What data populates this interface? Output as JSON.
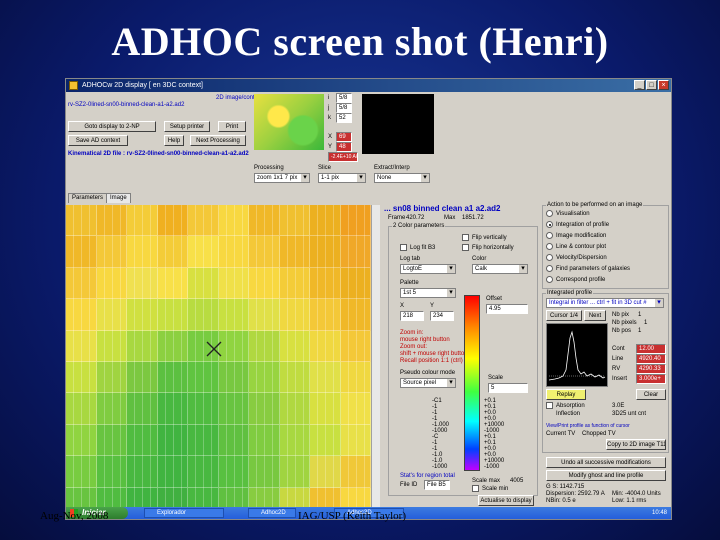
{
  "slide": {
    "title": "ADHOC screen shot (Henri)",
    "footer_left": "Aug-Nov, 2008",
    "footer_center": "IAG/USP (Keith Taylor)"
  },
  "window": {
    "title": "ADHOCw 2D display   [ en 3DC context]",
    "controls": [
      "_",
      "□",
      "×"
    ]
  },
  "header": {
    "context_line1": "2D image/context modes:",
    "context_line2": "rv-SZ2-0lined-sn00-binned-clean-a1-a2.ad2",
    "loaded_file": "Kinematical 2D file : rv-SZ2-0lined-sn00-binned-clean-a1-a2.ad2",
    "i_label": "i",
    "i_value": "5/8",
    "j_label": "j",
    "j_value": "5/8",
    "k_label": "k",
    "k_value": "52",
    "x_label": "X",
    "x_value": "69",
    "y_label": "Y",
    "y_value": "48",
    "coord_value": "-2.4E+10 A/R",
    "processing_label": "Processing",
    "processing_value": "zoom 1x1 7 pix",
    "slice_label": "Slice",
    "slice_value": "1-1 pix",
    "extra_label": "Extract/Interp",
    "extra_value": "None"
  },
  "toolbar": {
    "goto_label": "Goto display to 2-NP",
    "setup_label": "Setup printer",
    "print_label": "Print",
    "save_label": "Save AD context",
    "help_label": "Help",
    "next_label": "Next Processing"
  },
  "tabs": [
    {
      "label": "Parameters"
    },
    {
      "label": "Image"
    }
  ],
  "right_panel": {
    "file_title": "... sn08 binned clean a1 a2.ad2",
    "frame_label": "Frame",
    "frame_value": "420.72",
    "max_label": "Max",
    "max_value": "1851.72",
    "color_params_label": "2 Color parameters",
    "flip_vertically": "Flip vertically",
    "log_fit": "Log fit B3",
    "flip_horizontally": "Flip horizontally",
    "log_tab_label": "Log tab",
    "log_tab_value": "LogtoE",
    "color_label": "Color",
    "color_value": "Calk",
    "palette_label": "Palette",
    "palette_value": "1st 5",
    "offset_label": "Offset",
    "offset_value": "4.95",
    "zoom_x_label": "X",
    "zoom_x": "1",
    "zoom_y_label": "Y",
    "zoom_y": "1",
    "box_x": "218",
    "box_y": "234",
    "zoom_info_1": "Zoom in:",
    "zoom_info_2": "mouse right button",
    "zoom_info_3": "Zoom out:",
    "zoom_info_4": "shift + mouse right button",
    "zoom_info_5": "Recall position 1:1 (ctrl)",
    "pseudo_label": "Pseudo colour mode",
    "pseudo_value": "Source pixel",
    "scale_label": "Scale",
    "scale_value": "5",
    "scale_max_label": "Scale max",
    "scale_max_value": "4005",
    "scale_min_label": "Scale min",
    "stats_line1": "Stat's for region total",
    "stats_line2": "File ID",
    "file_id_value": "File B5",
    "actualise_label": "Actualise to display",
    "colorbar_labels": [
      "-C1",
      "-1",
      "-1",
      "-1",
      "-1.000",
      "-1000",
      "-C",
      "-1",
      "-1",
      "-1.0",
      "-1.0",
      "-1000"
    ],
    "colorbar_right": [
      "+0.1",
      "+0.1",
      "+0.0",
      "+0.0",
      "+10000",
      "-1000",
      "+0.1",
      "+0.1",
      "+0.0",
      "+0.0",
      "+10000",
      "-1000"
    ]
  },
  "action_panel": {
    "title": "Action to be performed on an image",
    "options": [
      {
        "label": "Visualisation",
        "selected": false
      },
      {
        "label": "Integration of profile",
        "selected": true
      },
      {
        "label": "Image modification",
        "selected": false
      },
      {
        "label": "Line & contour plot",
        "selected": false
      },
      {
        "label": "Velocity/Dispersion",
        "selected": false
      },
      {
        "label": "Find parameters of galaxies",
        "selected": false
      },
      {
        "label": "Correspond profile",
        "selected": false
      }
    ],
    "integrated_label": "Integrated profile",
    "integrated_value": "Integral in filter ... ctrl + fit in 3D cut #",
    "prev_label": "Cursor 1/4",
    "next_label": "Next",
    "nb_pixels_label": "Nb pix",
    "nb_pixels_value": "1",
    "nb_slices_label": "Nb pixels",
    "nb_slices_value": "1",
    "nb_pos_label": "Nb pos",
    "nb_pos_value": "1",
    "cont_label": "Cont",
    "cont_value": "12.00",
    "line_label": "Line",
    "line_value": "4920.40",
    "rv_label": "RV",
    "rv_value": "4290.33",
    "inset_label": "Insert",
    "inset_value": "3.000e+",
    "clear_label": "Clear",
    "reply_label": "Replay",
    "absorption_label": "Absorption",
    "inflection_label": "Inflection",
    "inflection_value": "3.0E",
    "inflection_unit": "3D25 unt cnt",
    "view_profile_label": "View/Print profile as function of cursor",
    "current_label": "Current TV",
    "current_value": "Chopped TV",
    "copy_label": "Copy to 2D image T11",
    "undo_label": "Undo all successive modifications",
    "modify_label": "Modify ghost and line profile",
    "stats_1": "G S: 1142.715",
    "stats_2": "Dispersion: 2592.79 A",
    "stats_3": "Min: -4004.0 Units",
    "stats_4": "NBin: 0.5 e",
    "stats_5": "Low: 1.1 rms",
    "view_label": "View TV line profile"
  },
  "taskbar": {
    "start_label": "Iniciar",
    "tasks": [
      "Explorador",
      "Adhoc2D",
      "Adhoc3D"
    ],
    "clock": "10:48"
  },
  "colors": {
    "slide_bg": "#0a1a6a",
    "window_title": "#0a246a",
    "panel": "#d4d0c8"
  }
}
